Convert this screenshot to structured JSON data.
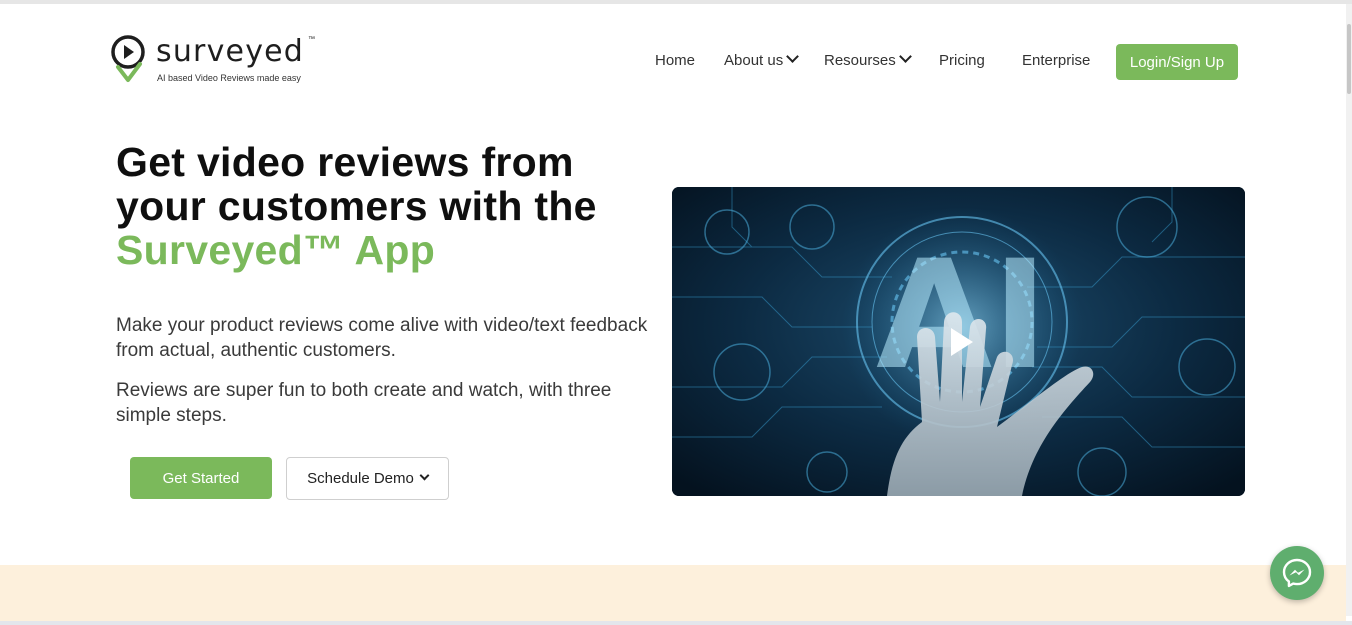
{
  "brand": {
    "name": "surveyed",
    "trademark": "™",
    "tagline": "AI based Video Reviews made easy"
  },
  "nav": {
    "items": [
      {
        "label": "Home",
        "has_dropdown": false
      },
      {
        "label": "About us",
        "has_dropdown": true
      },
      {
        "label": "Resourses",
        "has_dropdown": true
      },
      {
        "label": "Pricing",
        "has_dropdown": false
      },
      {
        "label": "Enterprise",
        "has_dropdown": false
      }
    ],
    "login_label": "Login/Sign Up"
  },
  "hero": {
    "title_line1": "Get video reviews from",
    "title_line2": "your customers with the",
    "title_highlight": "Surveyed™ App",
    "paragraph1": "Make your product reviews come alive with video/text feedback from actual, authentic customers.",
    "paragraph2": "Reviews are super fun to both create and watch, with three simple steps.",
    "get_started_label": "Get Started",
    "schedule_demo_label": "Schedule Demo",
    "video_overlay_text": "AI"
  },
  "icons": {
    "play": "play-icon",
    "messenger": "messenger-icon",
    "logo": "logo-pin-icon"
  },
  "colors": {
    "accent_green": "#7bb95b",
    "band": "#fdf0dc",
    "messenger": "#5fae6e"
  }
}
